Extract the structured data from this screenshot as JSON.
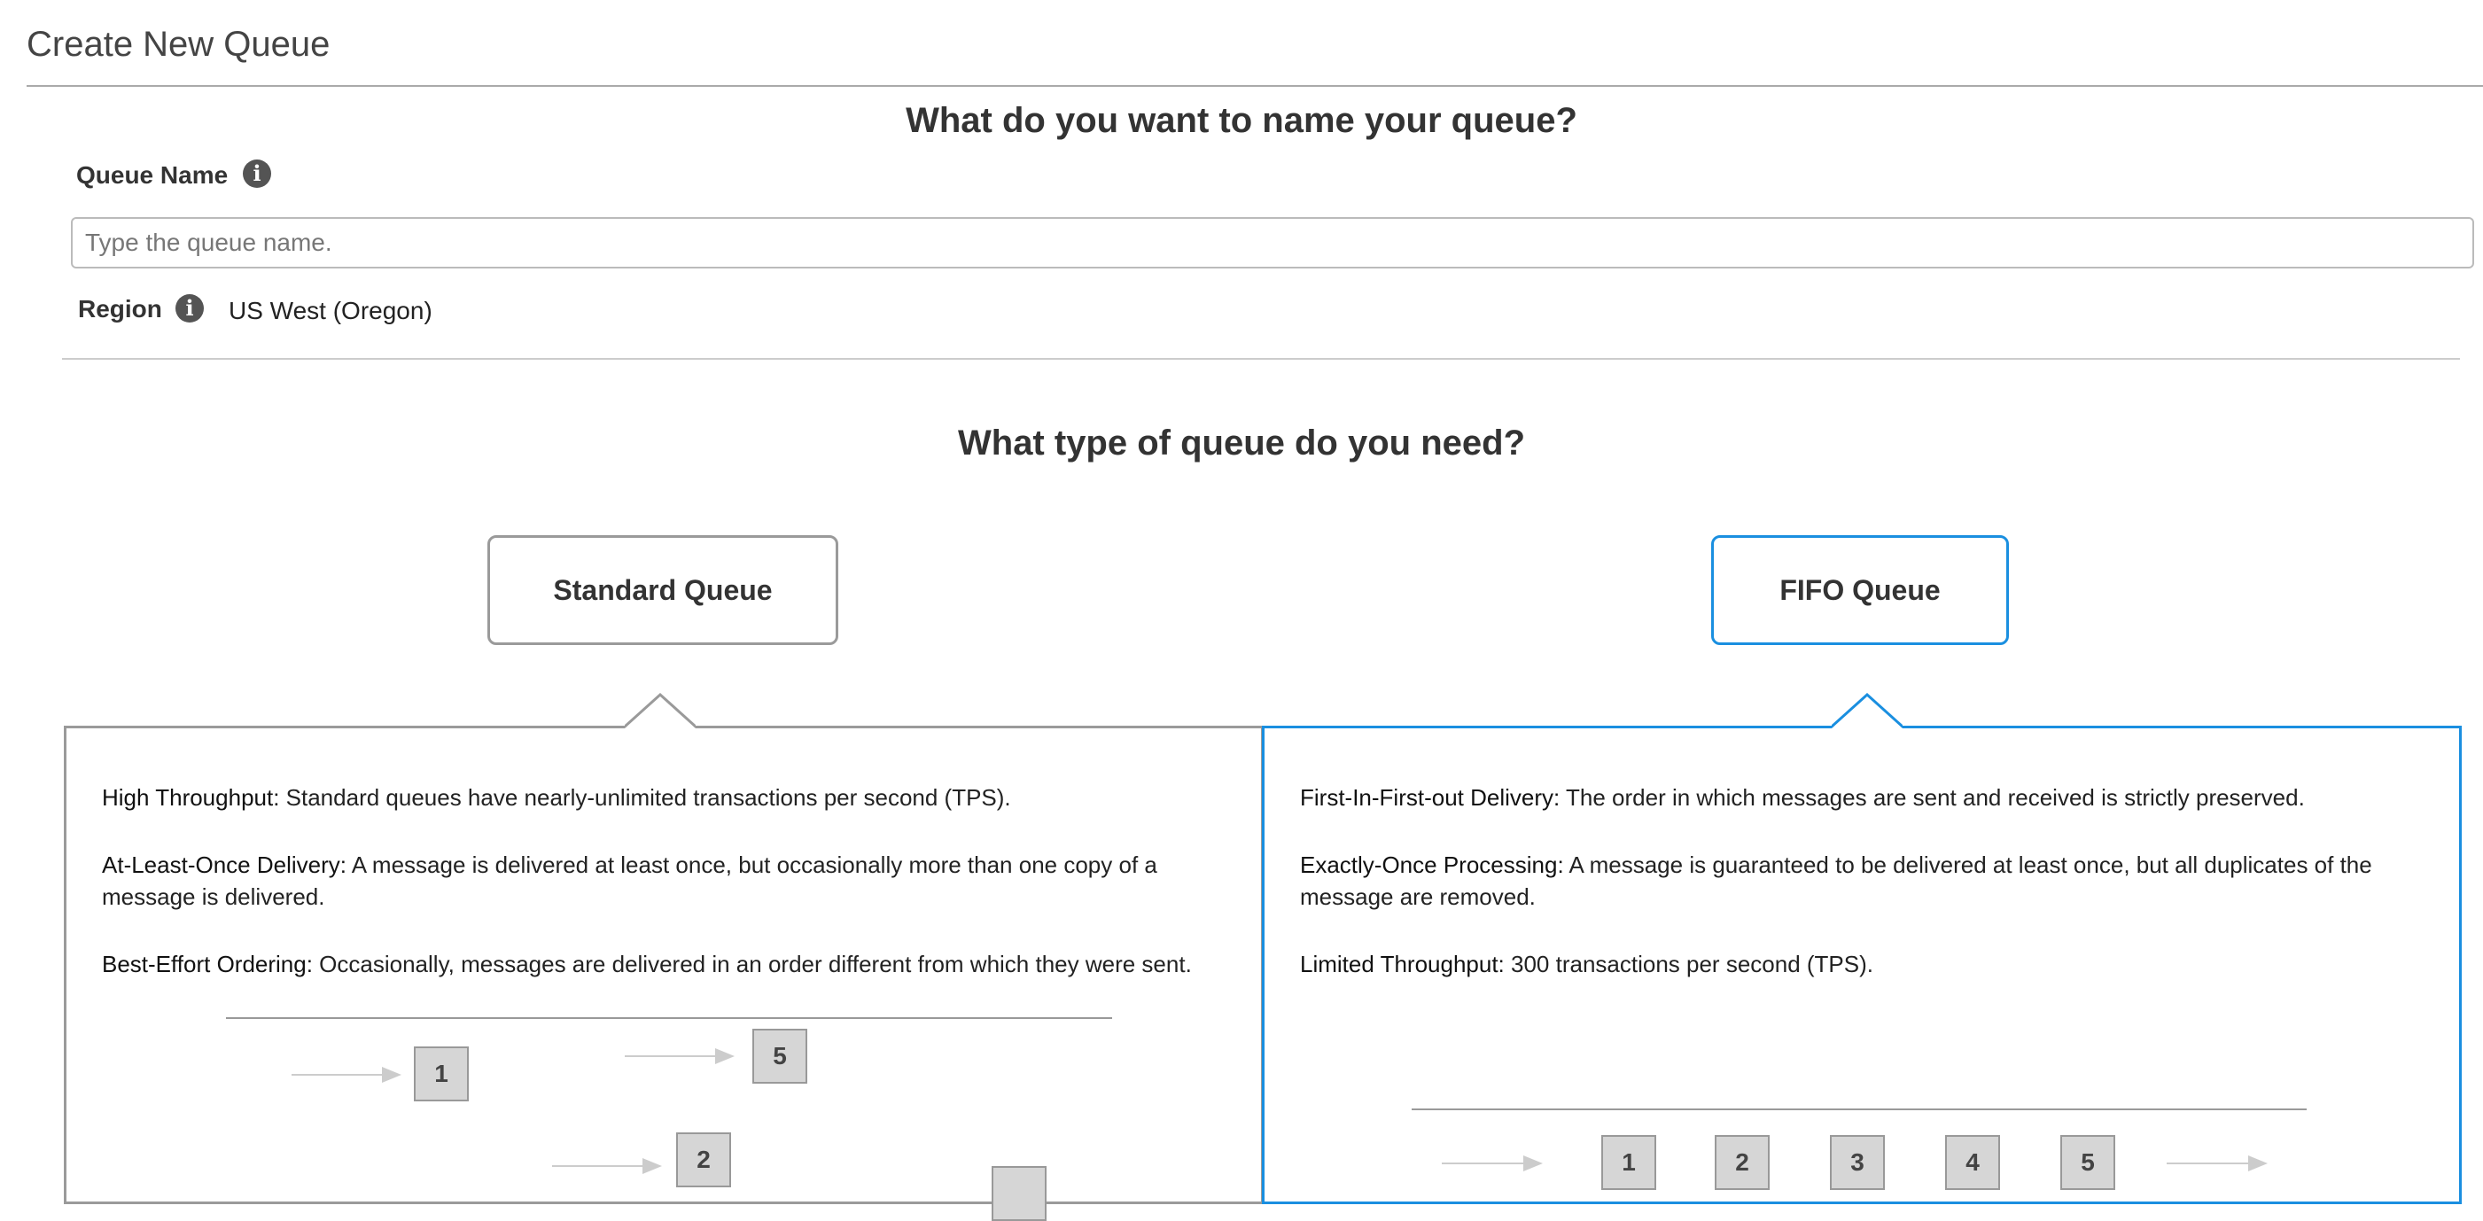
{
  "page": {
    "title": "Create New Queue"
  },
  "name_section": {
    "heading": "What do you want to name your queue?",
    "queue_name_label": "Queue Name",
    "queue_name_placeholder": "Type the queue name.",
    "queue_name_value": "",
    "region_label": "Region",
    "region_value": "US West (Oregon)",
    "info_icon": "info-icon"
  },
  "type_section": {
    "heading": "What type of queue do you need?",
    "selected": "FIFO Queue",
    "standard": {
      "button_label": "Standard Queue",
      "features": [
        {
          "term": "High Throughput:",
          "text": " Standard queues have nearly-unlimited transactions per second (TPS)."
        },
        {
          "term": "At-Least-Once Delivery:",
          "text": " A message is delivered at least once, but occasionally more than one copy of a message is delivered."
        },
        {
          "term": "Best-Effort Ordering:",
          "text": " Occasionally, messages are delivered in an order different from which they were sent."
        }
      ],
      "diagram_boxes": [
        "1",
        "5",
        "2",
        ""
      ]
    },
    "fifo": {
      "button_label": "FIFO Queue",
      "features": [
        {
          "term": "First-In-First-out Delivery:",
          "text": " The order in which messages are sent and received is strictly preserved."
        },
        {
          "term": "Exactly-Once Processing:",
          "text": " A message is guaranteed to be delivered at least once, but all duplicates of the message are removed."
        },
        {
          "term": "Limited Throughput:",
          "text": " 300 transactions per second (TPS)."
        }
      ],
      "diagram_boxes": [
        "1",
        "2",
        "3",
        "4",
        "5"
      ]
    }
  },
  "colors": {
    "accent": "#1a8fe0",
    "neutral_border": "#9a9a9a",
    "box_fill": "#d6d6d6"
  }
}
